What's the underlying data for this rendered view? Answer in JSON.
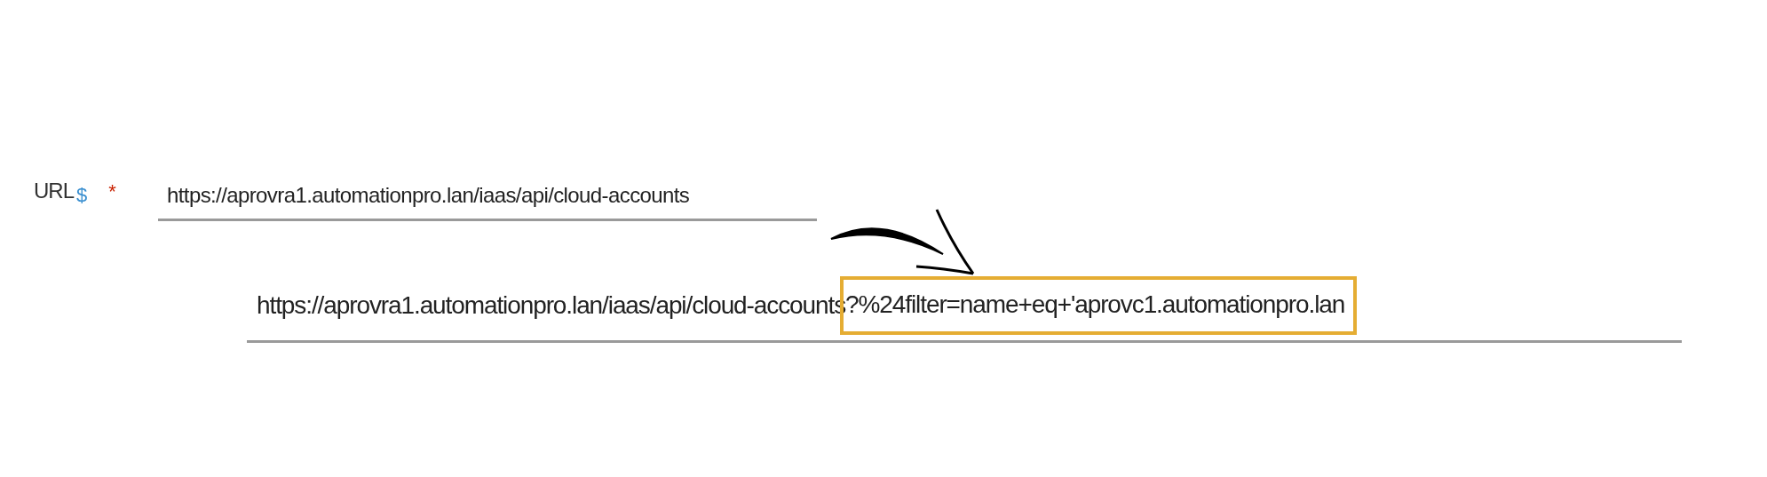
{
  "url_field": {
    "label": "URL",
    "binding_icon": "$",
    "required_mark": "*",
    "value": "https://aprovra1.automationpro.lan/iaas/api/cloud-accounts"
  },
  "expanded_url": {
    "value": "https://aprovra1.automationpro.lan/iaas/api/cloud-accounts",
    "highlighted": "?%24filter=name+eq+'aprovc1.automationpro.lan"
  }
}
